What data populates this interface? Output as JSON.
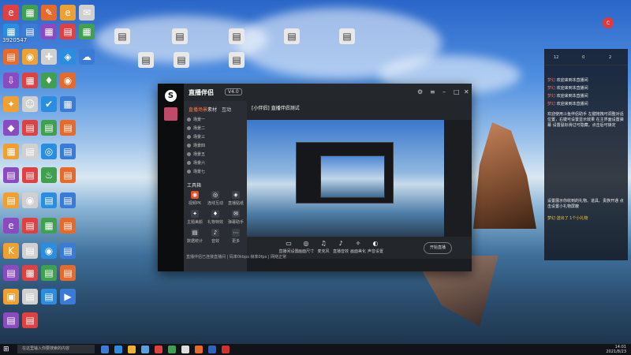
{
  "desktop": {
    "user_id": "3920547",
    "icons": [
      "e",
      "▦",
      "✎",
      "e",
      "✉",
      "▦",
      "▤",
      "▦",
      "▤",
      "▦",
      "▤",
      "◉",
      "✚",
      "◈",
      "☁",
      "⇩",
      "▦",
      "♦",
      "◉",
      "✦",
      "☺",
      "✔",
      "▦",
      "◆",
      "▤",
      "▤",
      "▤",
      "▦",
      "▤",
      "◎",
      "▤",
      "▤",
      "▤",
      "♨",
      "▤",
      "▤",
      "◉",
      "▤",
      "▤",
      "e",
      "▤",
      "▦",
      "▤",
      "K",
      "▤",
      "◉",
      "▤",
      "▤",
      "▦",
      "▤",
      "▤",
      "▣",
      "▤",
      "▤",
      "▶",
      "▤",
      "▤"
    ]
  },
  "app": {
    "name": "直播伴侣",
    "version": "V4.0",
    "tabs": [
      "直播场景",
      "素材",
      "互动"
    ],
    "scenes": [
      "场景一",
      "场景二",
      "场景三",
      "场景四",
      "场景五",
      "场景六",
      "场景七"
    ],
    "tools_header": "工具箱",
    "tools": [
      "视频PK",
      "连线互动",
      "直播贴纸",
      "主题美颜",
      "礼物特效",
      "弹幕助手",
      "数据统计",
      "音效",
      "更多"
    ],
    "stream_title": "[小伴侣] 直播伴侣测试",
    "bottom_tools": [
      "直播间设置",
      "画面尺寸",
      "麦克风",
      "直播音效",
      "画面美化",
      "声音设置"
    ],
    "start_label": "开始直播",
    "status": "直播伴侣已连接直播间 | 码率0kbps 帧率0fps | 网络正常"
  },
  "chat": {
    "stats": [
      "12",
      "0",
      "2"
    ],
    "messages": [
      {
        "name": "梦幻",
        "text": "欢迎来到本直播间"
      },
      {
        "name": "梦幻",
        "text": "欢迎来到本直播间"
      },
      {
        "name": "梦幻",
        "text": "欢迎来到本直播间"
      },
      {
        "name": "梦幻",
        "text": "欢迎来到本直播间"
      }
    ],
    "notice1": "欢迎使用斗鱼伴侣助手 左键拖拽可调整对话位置，右键可设置显示效果 在主界面设置弹幕 设置鼠标滑过可隐藏，点击后可锁定",
    "notice2": "设置展示你收到的礼物、道具、贵族开通 点击设置小礼物屏蔽",
    "gift_line": "梦幻 送出了 1个小礼物"
  },
  "taskbar": {
    "search_placeholder": "在这里输入你要搜索的内容",
    "time": "14:01",
    "date": "2021/8/23"
  }
}
